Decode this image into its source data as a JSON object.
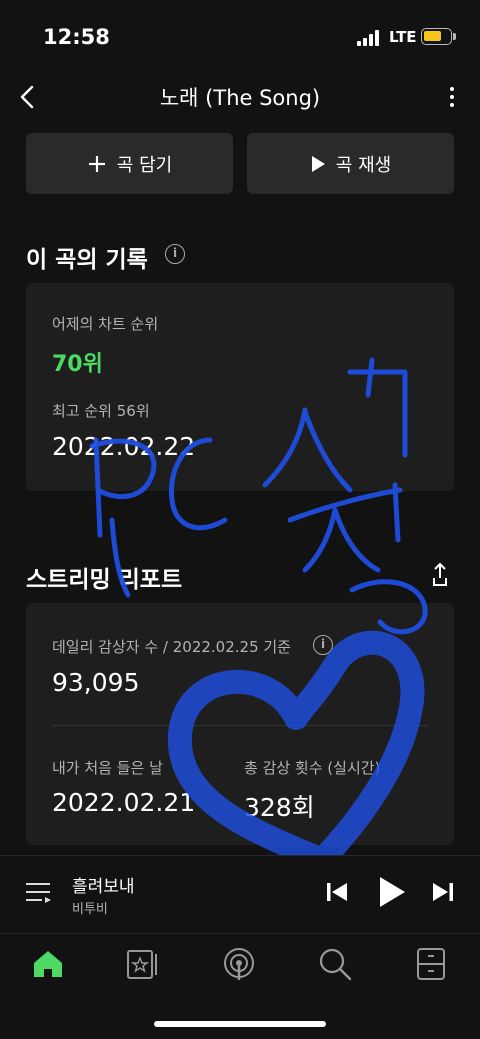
{
  "status_bar": {
    "time": "12:58",
    "network": "LTE"
  },
  "header": {
    "title": "노래 (The Song)"
  },
  "actions": {
    "add_label": "곡 담기",
    "play_label": "곡 재생"
  },
  "record": {
    "title": "이 곡의 기록",
    "yesterday_label": "어제의 차트 순위",
    "yesterday_rank": "70위",
    "best_label": "최고 순위 56위",
    "best_date": "2022.02.22"
  },
  "report": {
    "title": "스트리밍 리포트",
    "daily_label": "데일리 감상자 수 / 2022.02.25 기준",
    "daily_value": "93,095",
    "first_label": "내가 처음 들은 날",
    "first_value": "2022.02.21",
    "total_label": "총 감상 횟수 (실시간)",
    "total_value": "328회"
  },
  "player": {
    "track_title": "흘려보내",
    "artist": "비투비"
  },
  "colors": {
    "accent": "#4cd964",
    "background": "#121212",
    "card": "#1e1e1e",
    "doodle": "#1f4fe0"
  },
  "icons": [
    "back-icon",
    "more-icon",
    "plus-icon",
    "play-icon",
    "info-icon",
    "share-icon",
    "queue-icon",
    "previous-icon",
    "play-icon",
    "next-icon",
    "home-icon",
    "library-icon",
    "podcast-icon",
    "search-icon",
    "storage-icon"
  ]
}
